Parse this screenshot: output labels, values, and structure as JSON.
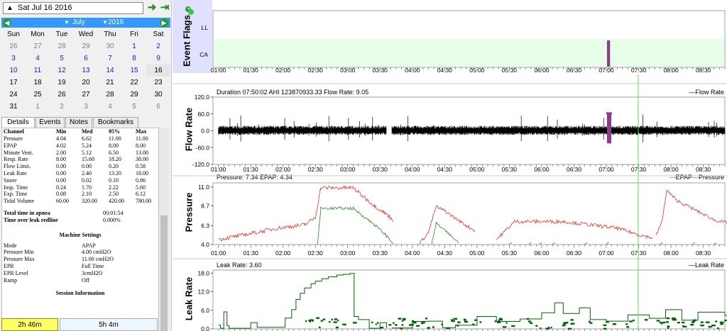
{
  "datebar": {
    "date_text": "Sat Jul 16 2016",
    "arrow_icon": "triangle-up-icon"
  },
  "calendar": {
    "month": "July",
    "year": "2016",
    "weekdays": [
      "Sun",
      "Mon",
      "Tue",
      "Wed",
      "Thu",
      "Fri",
      "Sat"
    ],
    "weeks": [
      [
        [
          "26",
          "gray"
        ],
        [
          "27",
          "gray"
        ],
        [
          "28",
          "gray"
        ],
        [
          "29",
          "gray"
        ],
        [
          "30",
          "gray"
        ],
        [
          "1",
          "blue"
        ],
        [
          "2",
          "blue"
        ]
      ],
      [
        [
          "3",
          "blue"
        ],
        [
          "4",
          "blue"
        ],
        [
          "5",
          "blue"
        ],
        [
          "6",
          "blue"
        ],
        [
          "7",
          "blue"
        ],
        [
          "8",
          "blue"
        ],
        [
          "9",
          "blue"
        ]
      ],
      [
        [
          "10",
          "blue"
        ],
        [
          "11",
          "blue"
        ],
        [
          "12",
          "blue"
        ],
        [
          "13",
          "blue"
        ],
        [
          "14",
          "blue"
        ],
        [
          "15",
          "blue"
        ],
        [
          "16",
          "sel"
        ]
      ],
      [
        [
          "17",
          "black"
        ],
        [
          "18",
          "black"
        ],
        [
          "19",
          "black"
        ],
        [
          "20",
          "black"
        ],
        [
          "21",
          "black"
        ],
        [
          "22",
          "black"
        ],
        [
          "23",
          "black"
        ]
      ],
      [
        [
          "24",
          "black"
        ],
        [
          "25",
          "black"
        ],
        [
          "26",
          "black"
        ],
        [
          "27",
          "black"
        ],
        [
          "28",
          "black"
        ],
        [
          "29",
          "black"
        ],
        [
          "30",
          "black"
        ]
      ],
      [
        [
          "31",
          "black"
        ],
        [
          "1",
          "gray"
        ],
        [
          "2",
          "gray"
        ],
        [
          "3",
          "gray"
        ],
        [
          "4",
          "gray"
        ],
        [
          "5",
          "gray"
        ],
        [
          "6",
          "gray"
        ]
      ]
    ]
  },
  "tabs": [
    "Details",
    "Events",
    "Notes",
    "Bookmarks"
  ],
  "stats": {
    "headers": [
      "Channel",
      "Min",
      "Med",
      "95%",
      "Max"
    ],
    "rows": [
      [
        "Pressure",
        "4.04",
        "6.62",
        "11.00",
        "11.00"
      ],
      [
        "EPAP",
        "4.02",
        "5.24",
        "8.00",
        "8.00"
      ],
      [
        "Minute Vent.",
        "2.00",
        "5.12",
        "6.50",
        "13.00"
      ],
      [
        "Resp. Rate",
        "8.00",
        "15.60",
        "18.20",
        "38.00"
      ],
      [
        "Flow Limit.",
        "0.00",
        "0.00",
        "0.20",
        "0.58"
      ],
      [
        "Leak Rate",
        "0.00",
        "2.40",
        "13.20",
        "18.00"
      ],
      [
        "Snore",
        "0.00",
        "0.02",
        "0.10",
        "0.86"
      ],
      [
        "Insp. Time",
        "0.24",
        "1.70",
        "2.22",
        "5.60"
      ],
      [
        "Exp. Time",
        "0.08",
        "2.10",
        "2.50",
        "6.12"
      ],
      [
        "Tidal Volume",
        "60.00",
        "320.00",
        "420.00",
        "780.00"
      ]
    ]
  },
  "summary": [
    [
      "Total time in apnea",
      "00:01:54"
    ],
    [
      "Time over leak redline",
      "0.000%"
    ]
  ],
  "machine_settings": {
    "title": "Machine Settings",
    "rows": [
      [
        "Mode",
        "APAP"
      ],
      [
        "Pressure Min",
        "4.00 cmH2O"
      ],
      [
        "Pressure Max",
        "11.00 cmH2O"
      ],
      [
        "EPR",
        "Full Time"
      ],
      [
        "EPR Level",
        "3cmH2O"
      ],
      [
        "Ramp",
        "Off"
      ]
    ]
  },
  "session_info": {
    "title": "Session Information",
    "sessions": [
      "2h 46m",
      "5h 4m"
    ]
  },
  "time_ticks": [
    "01:00",
    "01:30",
    "02:00",
    "02:30",
    "03:00",
    "03:30",
    "04:00",
    "04:30",
    "05:00",
    "05:30",
    "06:00",
    "06:30",
    "07:00",
    "07:30",
    "08:00",
    "08:30"
  ],
  "colors": {
    "calendar_header": "#3399ff",
    "nav_green": "#2c9a2c",
    "flags_band": "#e6ffe6",
    "event_marker": "#8e3a8e",
    "marker_line": "#66cc66",
    "epap": "#228b22",
    "pressure": "#e8312a",
    "flow": "#000000",
    "leak": "#006400"
  },
  "panels": {
    "event_flags": {
      "title": "Event Flags",
      "rows": [
        "LL",
        "CA"
      ]
    },
    "flow_rate": {
      "title": "Flow Rate",
      "info": "Duration 07:50:02 AHI 123870933.33 Flow Rate: 9.05",
      "legend": "Flow Rate",
      "yticks": [
        "120.0",
        "60.0",
        "0.0",
        "-60.0",
        "-120.0"
      ]
    },
    "pressure": {
      "title": "Pressure",
      "info": "Pressure: 7.34 EPAP: 4.34",
      "legend_a": "EPAP",
      "legend_b": "Pressure",
      "yticks": [
        "11.0",
        "8.7",
        "6.3",
        "4.0"
      ]
    },
    "leak_rate": {
      "title": "Leak Rate",
      "info": "Leak Rate: 3.60",
      "legend": "Leak Rate",
      "yticks": [
        "18.0",
        "12.0",
        "6.0",
        "0.0"
      ]
    }
  }
}
